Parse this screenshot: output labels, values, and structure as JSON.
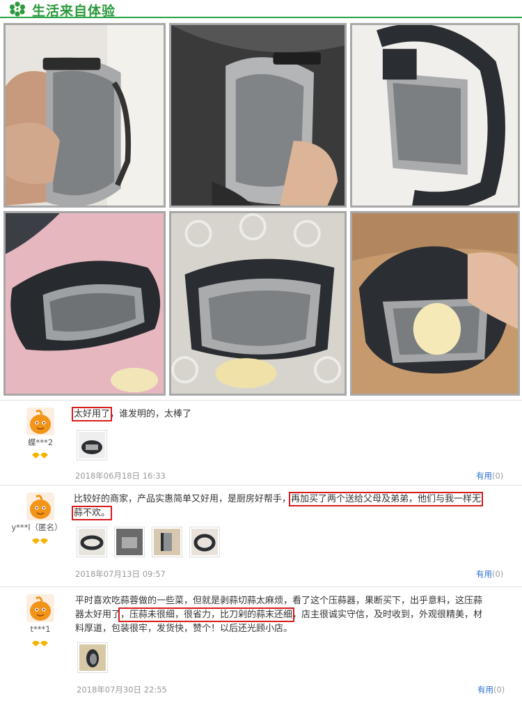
{
  "header": {
    "title": "生活来自体验",
    "icon": "flower-icon",
    "accent": "#2a9a3b"
  },
  "photos": [
    {
      "name": "garlic-press-photo-1",
      "subject": "hand holding press, steel side"
    },
    {
      "name": "garlic-press-photo-2",
      "subject": "hand holding press on black cushion"
    },
    {
      "name": "garlic-press-photo-3",
      "subject": "press standing on marble"
    },
    {
      "name": "garlic-press-photo-4",
      "subject": "press on pink surface with garlic"
    },
    {
      "name": "garlic-press-photo-5",
      "subject": "press on lace cloth with garlic"
    },
    {
      "name": "garlic-press-photo-6",
      "subject": "hand pressing garlic on cutting board"
    }
  ],
  "reviews": [
    {
      "user": "蝶***2",
      "text_highlight": "太好用了",
      "text_rest": "，谁发明的，太棒了",
      "date": "2018年06月18日 16:33",
      "useful_label": "有用",
      "useful_count": "(0)"
    },
    {
      "user": "y***l（匿名）",
      "text_before": "比较好的商家，产品实惠简单又好用，是厨房好帮手，",
      "text_highlight_1": "再加买了两个送给父母及弟弟，他们与我一样无",
      "text_highlight_2": "蒜不欢。",
      "date": "2018年07月13日 09:57",
      "useful_label": "有用",
      "useful_count": "(0)"
    },
    {
      "user": "t***1",
      "text_line1": "平时喜欢吃蒜蓉做的一些菜，但就是剥蒜切蒜太麻烦，看了这个压蒜器，果断买下，出乎意料，这压蒜",
      "text_line2_start": "器太好用了",
      "text_highlight": "，压蒜未很细，很省力，比刀剁的蒜末还细",
      "text_line2_end": "，店主很诚实守信，及时收到，外观很精美，材",
      "text_line3": "料厚道，包装很牢，发货快，赞个！以后还光顾小店。",
      "date": "2018年07月30日 22:55",
      "useful_label": "有用",
      "useful_count": "(0)"
    }
  ]
}
